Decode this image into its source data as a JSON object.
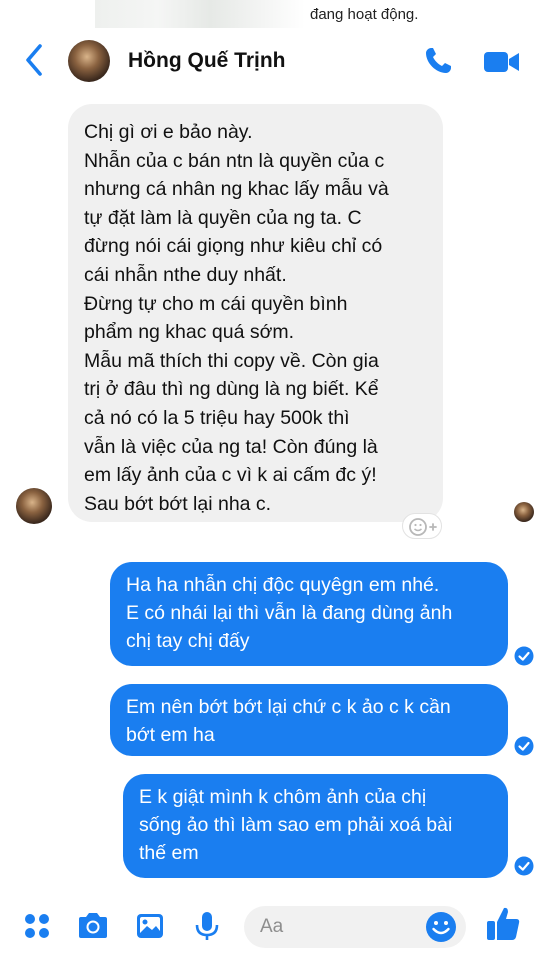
{
  "status": {
    "text": "đang hoạt động."
  },
  "header": {
    "title": "Hồng Quế Trịnh",
    "back_icon": "chevron-left-icon",
    "call_icon": "phone-icon",
    "video_icon": "video-camera-icon"
  },
  "messages": {
    "incoming": [
      {
        "lines": [
          "Chị gì ơi e bảo này.",
          "Nhẫn của c bán ntn là quyền của c",
          "nhưng cá nhân ng khac lấy mẫu và",
          "tự đặt làm là quyền của ng ta. C",
          "đừng nói cái giọng như kiêu chỉ có",
          "cái nhẫn nthe duy nhất.",
          "Đừng tự cho m cái quyền bình",
          "phẩm ng khac quá sớm.",
          "Mẫu mã thích thi copy về. Còn gia",
          "trị ở đâu thì ng dùng là ng biết. Kể",
          "cả nó có la 5 triệu hay 500k thì",
          "vẫn là việc của ng ta! Còn đúng là",
          "em lấy ảnh của c vì k ai cấm đc ý!",
          "Sau bớt bớt lại nha c."
        ]
      }
    ],
    "outgoing": [
      {
        "lines": [
          "Ha ha nhẫn chị độc quyêgn em nhé.",
          "E có nhái lại thì vẫn là đang dùng ảnh",
          "chị tay chị đấy"
        ]
      },
      {
        "lines": [
          "Em nên bớt bớt lại chứ c k ảo c k cần",
          "bớt em ha"
        ]
      },
      {
        "lines": [
          "E k giật mình k chôm ảnh của chị",
          "sống ảo thì làm sao em phải xoá bài",
          "thế em"
        ]
      }
    ]
  },
  "composer": {
    "placeholder": "Aa",
    "tools": [
      "grid-menu-icon",
      "camera-icon",
      "photo-icon",
      "microphone-icon"
    ],
    "emoji_icon": "smiley-icon",
    "like_icon": "thumbs-up-icon"
  },
  "colors": {
    "accent": "#1a7ef0",
    "incoming_bubble": "#f0f0f0"
  }
}
